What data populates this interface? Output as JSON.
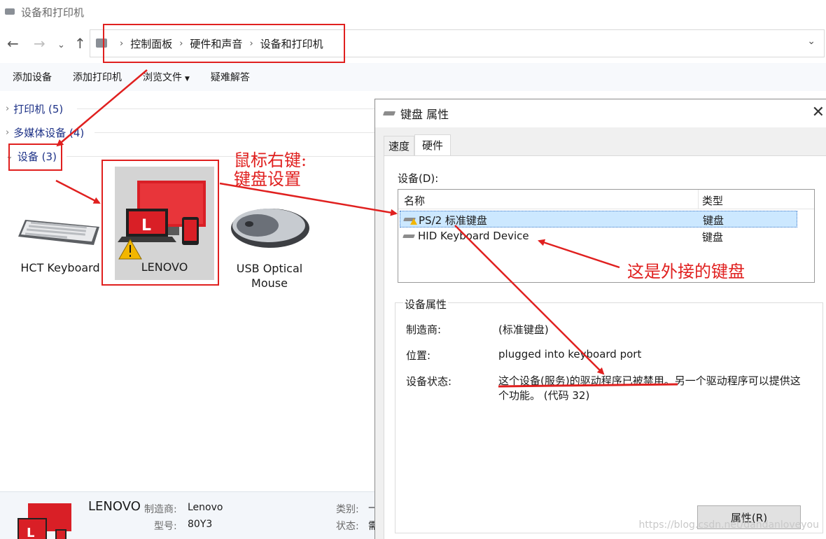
{
  "window": {
    "title": "设备和打印机"
  },
  "nav": {
    "back_glyph": "←",
    "forward_glyph": "→",
    "history_glyph": "⌄",
    "up_glyph": "↑",
    "dropdown_glyph": "⌄"
  },
  "breadcrumb": {
    "items": [
      "控制面板",
      "硬件和声音",
      "设备和打印机"
    ],
    "sep": "›"
  },
  "toolbar": {
    "add_device": "添加设备",
    "add_printer": "添加打印机",
    "browse_files": "浏览文件",
    "browse_caret": "▼",
    "troubleshoot": "疑难解答"
  },
  "groups": {
    "printers": "打印机 (5)",
    "multimedia": "多媒体设备 (4)",
    "devices": "设备 (3)",
    "chev_collapsed": "›",
    "chev_expanded": "⌄"
  },
  "devices": [
    {
      "name": "HCT Keyboard",
      "icon": "keyboard-icon"
    },
    {
      "name": "LENOVO",
      "icon": "computer-icon"
    },
    {
      "name_line1": "USB Optical",
      "name_line2": "Mouse",
      "icon": "mouse-icon"
    }
  ],
  "annotations": {
    "right_click_line1": "鼠标右键:",
    "right_click_line2": "键盘设置",
    "external_keyboard": "这是外接的键盘"
  },
  "details": {
    "name": "LENOVO",
    "manufacturer_label": "制造商:",
    "manufacturer_value": "Lenovo",
    "model_label": "型号:",
    "model_value": "80Y3",
    "category_label": "类别:",
    "category_value": "—",
    "status_label": "状态:",
    "status_value": "需"
  },
  "dialog": {
    "title": "键盘 属性",
    "close_glyph": "✕",
    "tabs": [
      "速度",
      "硬件"
    ],
    "devices_label": "设备(D):",
    "columns": {
      "name": "名称",
      "type": "类型"
    },
    "rows": [
      {
        "name": "PS/2 标准键盘",
        "type": "键盘",
        "selected": true,
        "warning": true
      },
      {
        "name": "HID Keyboard Device",
        "type": "键盘",
        "selected": false,
        "warning": false
      }
    ],
    "props_title": "设备属性",
    "manufacturer_label": "制造商:",
    "manufacturer_value": "(标准键盘)",
    "location_label": "位置:",
    "location_value": "plugged into keyboard port",
    "status_label": "设备状态:",
    "status_value_underlined": "这个设备(服务)的驱动程序已被禁用。",
    "status_value_rest": "另一个驱动程序可以提供这个功能。 (代码 32)",
    "properties_button": "属性(R)"
  },
  "watermark": "https://blog.csdn.net/dandanloveyou",
  "colors": {
    "annotation_red": "#e0201f",
    "group_blue": "#1e3287",
    "selection_blue": "#cce8ff"
  }
}
